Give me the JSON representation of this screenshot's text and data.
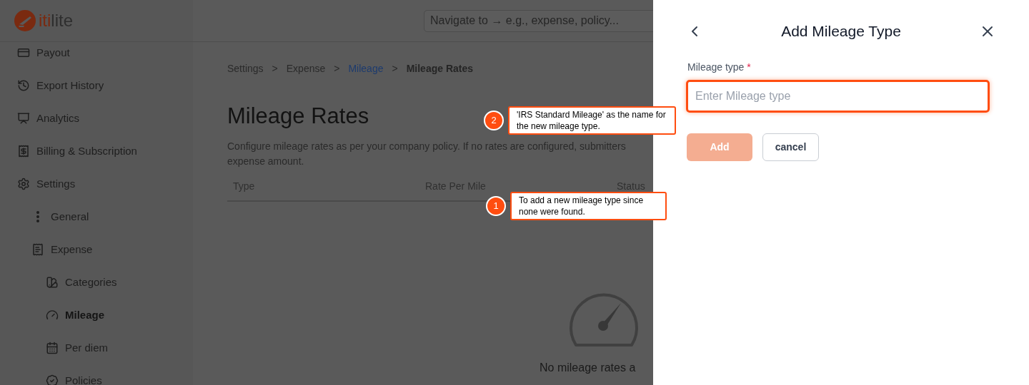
{
  "logo": {
    "text_a": "iti",
    "text_b": "lite"
  },
  "search": {
    "placeholder": "Navigate to → e.g., expense, policy..."
  },
  "sidebar": {
    "items": [
      {
        "label": "Payout",
        "selected": false
      },
      {
        "label": "Export History",
        "selected": false
      },
      {
        "label": "Analytics",
        "selected": false
      },
      {
        "label": "Billing & Subscription",
        "selected": false
      },
      {
        "label": "Settings",
        "selected": false,
        "children": [
          {
            "label": "General",
            "selected": false
          },
          {
            "label": "Expense",
            "selected": false,
            "children": [
              {
                "label": "Categories",
                "selected": false
              },
              {
                "label": "Mileage",
                "selected": true
              },
              {
                "label": "Per diem",
                "selected": false
              },
              {
                "label": "Policies",
                "selected": false
              }
            ]
          }
        ]
      }
    ]
  },
  "breadcrumb": [
    {
      "label": "Settings",
      "kind": "plain"
    },
    {
      "label": "Expense",
      "kind": "plain"
    },
    {
      "label": "Mileage",
      "kind": "link"
    },
    {
      "label": "Mileage Rates",
      "kind": "current"
    }
  ],
  "breadcrumb_separator": ">",
  "page_title": "Mileage Rates",
  "description_lines": [
    "Configure mileage rates as per your company policy. If no rates are configured, submitters",
    "expense amount."
  ],
  "table": {
    "columns": [
      "Type",
      "Rate Per Mile",
      "Status"
    ]
  },
  "empty_state": {
    "message": "No mileage rates a"
  },
  "drawer": {
    "title": "Add Mileage Type",
    "field": {
      "label": "Mileage type",
      "required_mark": "*",
      "placeholder": "Enter Mileage type",
      "focused": true
    },
    "buttons": [
      {
        "label": "Add",
        "kind": "primary",
        "disabled": true
      },
      {
        "label": "cancel",
        "kind": "secondary",
        "disabled": false
      }
    ]
  },
  "annotations": [
    {
      "number": "2",
      "text": "'IRS Standard Mileage' as the name for the new mileage type."
    },
    {
      "number": "1",
      "text": "To add a new mileage type since none were found."
    }
  ]
}
